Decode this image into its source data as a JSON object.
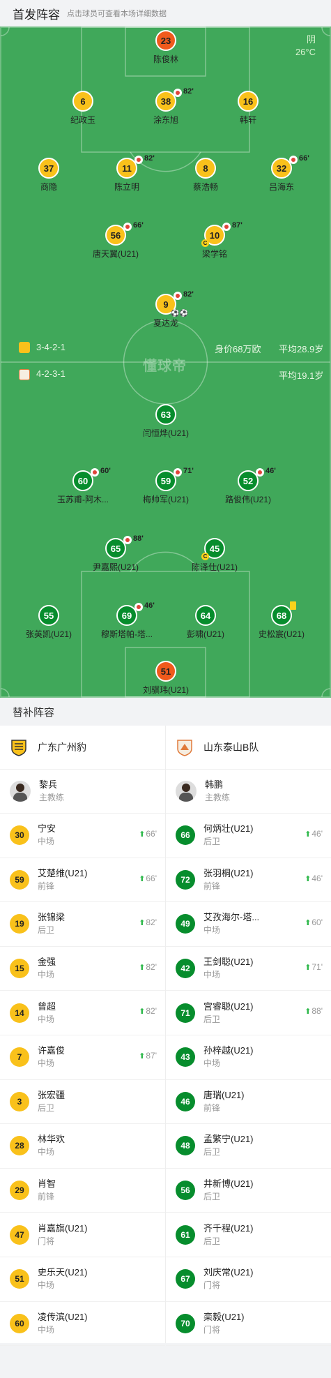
{
  "header": {
    "title": "首发阵容",
    "subtitle": "点击球员可查看本场详细数据"
  },
  "weather": {
    "condition": "阴",
    "temp": "26°C"
  },
  "home": {
    "formation": "3-4-2-1",
    "value": "身价68万欧",
    "age": "平均28.9岁"
  },
  "away": {
    "formation": "4-2-3-1",
    "age": "平均19.1岁"
  },
  "watermark": "懂球帝",
  "away_players": [
    {
      "num": "23",
      "name": "陈俊林",
      "color": "o"
    },
    {
      "num": "6",
      "name": "纪政玉",
      "color": "y"
    },
    {
      "num": "38",
      "name": "涂东旭",
      "color": "y",
      "sub": "82'"
    },
    {
      "num": "16",
      "name": "韩轩",
      "color": "y"
    },
    {
      "num": "37",
      "name": "商隐",
      "color": "y"
    },
    {
      "num": "11",
      "name": "陈立明",
      "color": "y",
      "sub": "82'"
    },
    {
      "num": "8",
      "name": "蔡浩畅",
      "color": "y"
    },
    {
      "num": "32",
      "name": "吕海东",
      "color": "y",
      "sub": "66'"
    },
    {
      "num": "56",
      "name": "唐天翼(U21)",
      "color": "y",
      "sub": "66'"
    },
    {
      "num": "10",
      "name": "梁学铭",
      "color": "y",
      "sub": "87'",
      "captain": "C"
    },
    {
      "num": "9",
      "name": "夏达龙",
      "color": "y",
      "sub": "82'",
      "goals": "⚽⚽"
    }
  ],
  "home_players": [
    {
      "num": "63",
      "name": "闫恒烨(U21)",
      "color": "g"
    },
    {
      "num": "60",
      "name": "玉苏甫-阿木...",
      "color": "g",
      "sub": "60'"
    },
    {
      "num": "59",
      "name": "梅帅军(U21)",
      "color": "g",
      "sub": "71'"
    },
    {
      "num": "52",
      "name": "路俊伟(U21)",
      "color": "g",
      "sub": "46'"
    },
    {
      "num": "65",
      "name": "尹嘉熙(U21)",
      "color": "g",
      "sub": "88'"
    },
    {
      "num": "45",
      "name": "陈泽仕(U21)",
      "color": "g",
      "captain": "C"
    },
    {
      "num": "55",
      "name": "张英凯(U21)",
      "color": "g"
    },
    {
      "num": "69",
      "name": "穆斯塔帕-塔...",
      "color": "g",
      "sub": "46'"
    },
    {
      "num": "64",
      "name": "彭啸(U21)",
      "color": "g"
    },
    {
      "num": "68",
      "name": "史松宸(U21)",
      "color": "g",
      "card": "yellow"
    },
    {
      "num": "51",
      "name": "刘骐玮(U21)",
      "color": "o"
    }
  ],
  "bench": {
    "title": "替补阵容",
    "left": {
      "team": "广东广州豹",
      "coach": "黎兵",
      "coach_role": "主教练",
      "players": [
        {
          "num": "30",
          "name": "宁安",
          "pos": "中场",
          "time": "66'"
        },
        {
          "num": "59",
          "name": "艾楚维(U21)",
          "pos": "前锋",
          "time": "66'"
        },
        {
          "num": "19",
          "name": "张锦梁",
          "pos": "后卫",
          "time": "82'"
        },
        {
          "num": "15",
          "name": "金强",
          "pos": "中场",
          "time": "82'"
        },
        {
          "num": "14",
          "name": "曾超",
          "pos": "中场",
          "time": "82'"
        },
        {
          "num": "7",
          "name": "许嘉俊",
          "pos": "中场",
          "time": "87'"
        },
        {
          "num": "3",
          "name": "张宏疆",
          "pos": "后卫"
        },
        {
          "num": "28",
          "name": "林华欢",
          "pos": "中场"
        },
        {
          "num": "29",
          "name": "肖智",
          "pos": "前锋"
        },
        {
          "num": "47",
          "name": "肖嘉旗(U21)",
          "pos": "门将"
        },
        {
          "num": "51",
          "name": "史乐天(U21)",
          "pos": "中场"
        },
        {
          "num": "60",
          "name": "凌传滨(U21)",
          "pos": "中场"
        }
      ]
    },
    "right": {
      "team": "山东泰山B队",
      "coach": "韩鹏",
      "coach_role": "主教练",
      "players": [
        {
          "num": "66",
          "name": "何炳壮(U21)",
          "pos": "后卫",
          "time": "46'"
        },
        {
          "num": "72",
          "name": "张羽桐(U21)",
          "pos": "前锋",
          "time": "46'"
        },
        {
          "num": "49",
          "name": "艾孜海尔-塔...",
          "pos": "中场",
          "time": "60'"
        },
        {
          "num": "42",
          "name": "王剑聪(U21)",
          "pos": "中场",
          "time": "71'"
        },
        {
          "num": "71",
          "name": "宫睿聪(U21)",
          "pos": "后卫",
          "time": "88'"
        },
        {
          "num": "43",
          "name": "孙梓越(U21)",
          "pos": "中场"
        },
        {
          "num": "46",
          "name": "唐瑞(U21)",
          "pos": "前锋"
        },
        {
          "num": "48",
          "name": "孟繁宁(U21)",
          "pos": "后卫"
        },
        {
          "num": "56",
          "name": "井新博(U21)",
          "pos": "后卫"
        },
        {
          "num": "61",
          "name": "齐千程(U21)",
          "pos": "后卫"
        },
        {
          "num": "67",
          "name": "刘庆常(U21)",
          "pos": "门将"
        },
        {
          "num": "70",
          "name": "栾毅(U21)",
          "pos": "门将"
        }
      ]
    }
  }
}
